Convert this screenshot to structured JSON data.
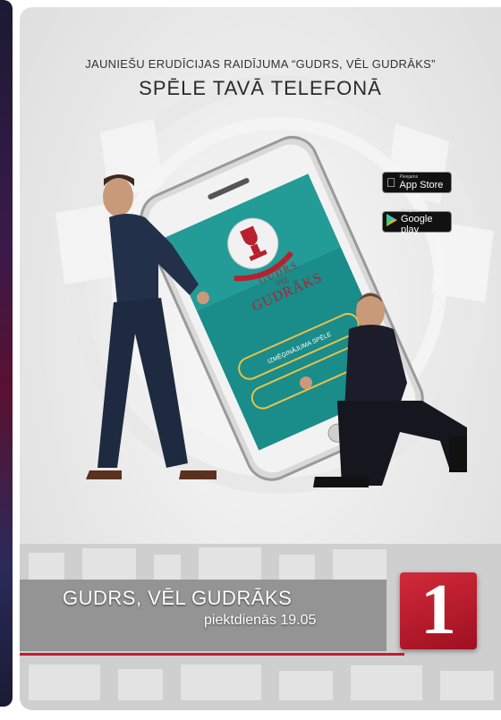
{
  "header": {
    "line1": "JAUNIEŠU ERUDĪCIJAS RAIDĪJUMA “GUDRS, VĒL GUDRĀKS”",
    "line2": "SPĒLE TAVĀ TELEFONĀ"
  },
  "stores": {
    "apple_small": "Pieejams",
    "apple_big": "App Store",
    "google_small": "Pieejams",
    "google_big": "Google play"
  },
  "phone": {
    "logo_line1": "GUDRS",
    "logo_line2": "VĒL",
    "logo_line3": "GUDRĀKS",
    "trial_button": "IZMĒĢINĀJUMA SPĒLE"
  },
  "footer": {
    "show_title": "GUDRS, VĒL GUDRĀKS",
    "schedule": "piektdienās 19.05",
    "channel_number": "1"
  },
  "colors": {
    "channel_red": "#c41e2e",
    "phone_screen": "#1a8c8a",
    "button_gold": "#e8c24a"
  },
  "icons": [
    "apple-icon",
    "google-play-icon"
  ]
}
